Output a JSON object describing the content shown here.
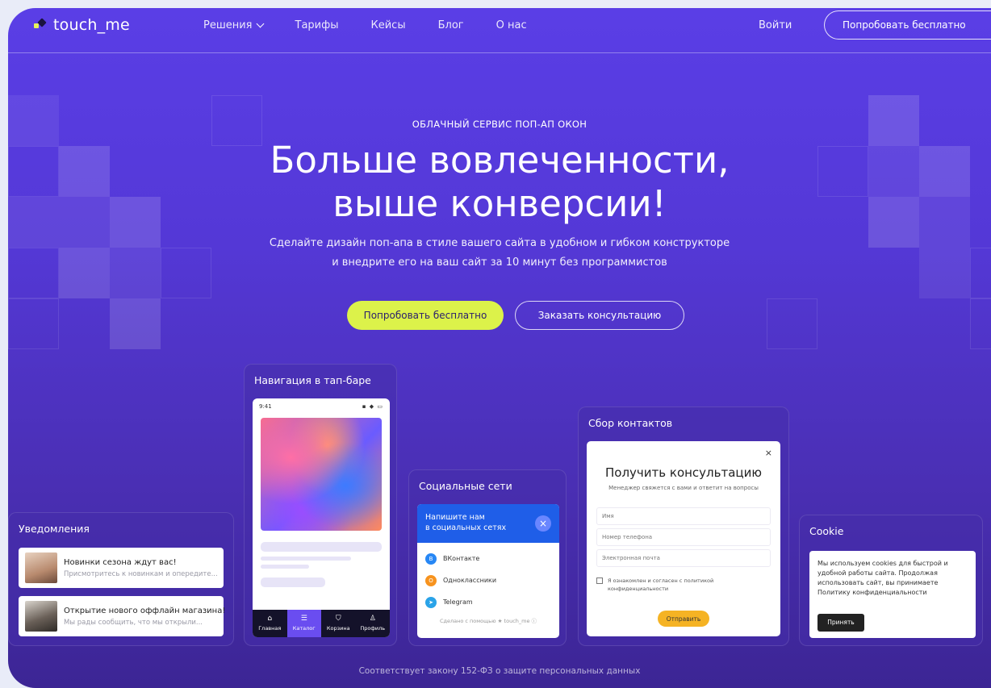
{
  "logo": {
    "text": "touch_me"
  },
  "nav": [
    {
      "label": "Решения"
    },
    {
      "label": "Тарифы"
    },
    {
      "label": "Кейсы"
    },
    {
      "label": "Блог"
    },
    {
      "label": "О нас"
    }
  ],
  "header": {
    "login": "Войти",
    "try": "Попробовать бесплатно"
  },
  "hero": {
    "eyebrow": "ОБЛАЧНЫЙ СЕРВИС ПОП-АП ОКОН",
    "title_line1": "Больше вовлеченности,",
    "title_line2": "выше конверсии!",
    "subtitle_line1": "Сделайте дизайн поп-апа в стиле вашего сайта в удобном и гибком конструкторе",
    "subtitle_line2": "и внедрите его на ваш сайт за 10 минут без программистов",
    "cta_primary": "Попробовать бесплатно",
    "cta_secondary": "Заказать консультацию"
  },
  "cards": {
    "notifications": {
      "title": "Уведомления",
      "items": [
        {
          "title": "Новинки сезона ждут вас!",
          "text": "Присмотритесь к новинкам и опередите..."
        },
        {
          "title": "Открытие нового оффлайн магазина!",
          "text": "Мы рады сообщить, что мы открыли..."
        }
      ]
    },
    "tabbar": {
      "title": "Навигация в тап-баре",
      "status_time": "9:41",
      "status_icons": "▪ ◆ ▭",
      "tabs": [
        {
          "icon": "⌂",
          "label": "Главная"
        },
        {
          "icon": "☰",
          "label": "Каталог"
        },
        {
          "icon": "⛉",
          "label": "Корзина"
        },
        {
          "icon": "♙",
          "label": "Профиль"
        }
      ]
    },
    "social": {
      "title": "Социальные сети",
      "head_line1": "Напишите нам",
      "head_line2": "в социальных сетях",
      "close": "×",
      "items": [
        {
          "label": "ВКонтакте",
          "icon": "vk-icon",
          "color": "#2787f5",
          "glyph": "B"
        },
        {
          "label": "Одноклассники",
          "icon": "ok-icon",
          "color": "#f7931e",
          "glyph": "O"
        },
        {
          "label": "Telegram",
          "icon": "telegram-icon",
          "color": "#2aa3e8",
          "glyph": "➤"
        }
      ],
      "footer": "Сделано с помощью ★ touch_me ⓘ"
    },
    "contacts": {
      "title": "Сбор контактов",
      "close": "×",
      "form_title": "Получить консультацию",
      "form_subtitle": "Менеджер свяжется с вами и ответит на вопросы",
      "fields": [
        {
          "placeholder": "Имя"
        },
        {
          "placeholder": "Номер телефона"
        },
        {
          "placeholder": "Электронная почта"
        }
      ],
      "consent": "Я ознакомлен и согласен с политикой конфиденциальности",
      "submit": "Отправить"
    },
    "cookie": {
      "title": "Cookie",
      "text": "Мы используем cookies для быстрой и удобной работы сайта. Продолжая использовать сайт, вы принимаете Политику конфиденциальности",
      "button": "Принять"
    }
  },
  "footer_note": "Соответствует закону 152-ФЗ о защите персональных данных",
  "colors": {
    "brand": "#5a3ee6",
    "accent": "#dcf24a",
    "social_head": "#1f5ee8",
    "submit": "#f5b324"
  }
}
